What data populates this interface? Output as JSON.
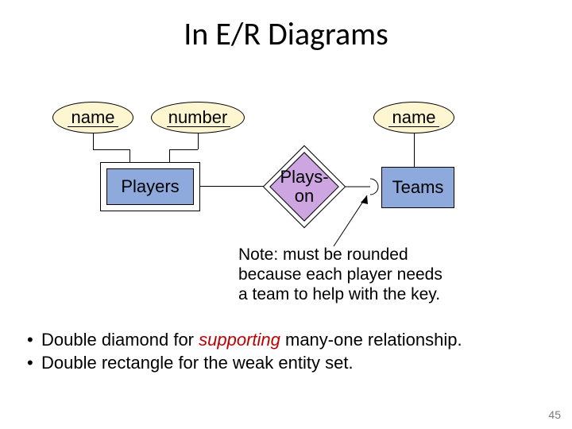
{
  "title": "In E/R Diagrams",
  "attributes": {
    "playerName": "name",
    "playerNumber": "number",
    "teamName": "name"
  },
  "entities": {
    "players": "Players",
    "teams": "Teams"
  },
  "relationship": {
    "playsOn": "Plays-\non"
  },
  "note": {
    "line1": "Note: must be rounded",
    "line2": "because each player needs",
    "line3": "a team to help with the key."
  },
  "bullets": {
    "b1_pre": "Double diamond for ",
    "b1_em": "supporting",
    "b1_post": "  many-one relationship.",
    "b2": "Double rectangle for the weak entity set."
  },
  "pageNumber": "45"
}
